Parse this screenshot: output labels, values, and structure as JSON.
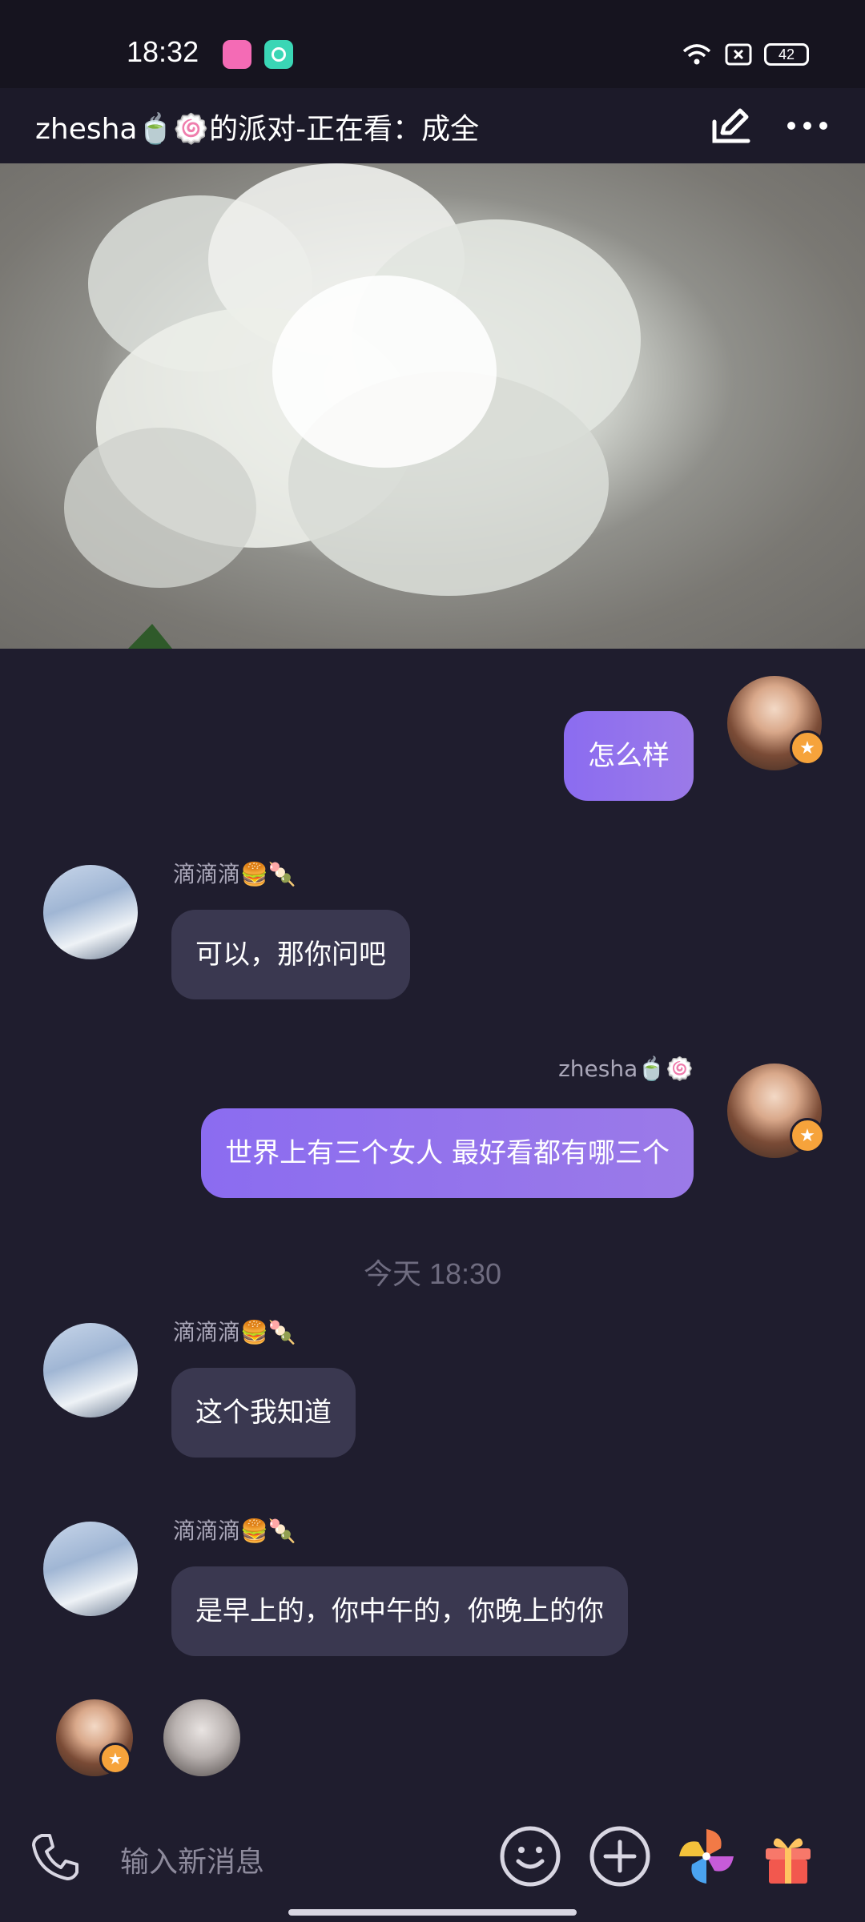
{
  "status_bar": {
    "time": "18:32",
    "battery": "42"
  },
  "header": {
    "title": "zhesha🍵🍥的派对-正在看：成全"
  },
  "messages": [
    {
      "sender": "zhesha🍵🍥",
      "text": "怎么样",
      "direction": "out"
    },
    {
      "sender": "滴滴滴🍔🍡",
      "text": "可以，那你问吧",
      "direction": "in"
    },
    {
      "sender": "zhesha🍵🍥",
      "text": "世界上有三个女人 最好看都有哪三个",
      "direction": "out"
    },
    {
      "sender": "滴滴滴🍔🍡",
      "text": "这个我知道",
      "direction": "in"
    },
    {
      "sender": "滴滴滴🍔🍡",
      "text": "是早上的，你中午的，你晚上的你",
      "direction": "in"
    }
  ],
  "timestamp": "今天 18:30",
  "input": {
    "placeholder": "输入新消息"
  },
  "icons": [
    "phone-icon",
    "emoji-icon",
    "plus-icon",
    "pinwheel-icon",
    "gift-icon",
    "edit-icon",
    "more-icon"
  ],
  "colors": {
    "accent_bubble": "#8b6cf0",
    "incoming_bubble": "#3a3850",
    "background": "#1f1d2e"
  }
}
